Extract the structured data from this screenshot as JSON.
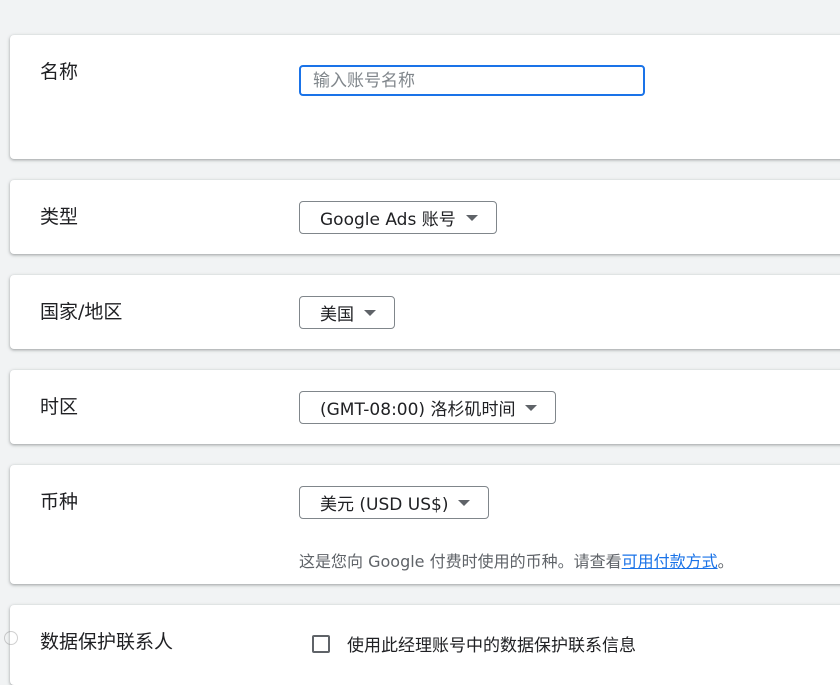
{
  "form": {
    "name": {
      "label": "名称",
      "placeholder": "输入账号名称",
      "value": ""
    },
    "type": {
      "label": "类型",
      "selected": "Google Ads 账号"
    },
    "country": {
      "label": "国家/地区",
      "selected": "美国"
    },
    "timezone": {
      "label": "时区",
      "selected": "(GMT-08:00) 洛杉矶时间"
    },
    "currency": {
      "label": "币种",
      "selected": "美元 (USD US$)",
      "helper_text": "这是您向 Google 付费时使用的币种。请查看",
      "helper_link": "可用付款方式",
      "helper_suffix": "。"
    },
    "data_protection": {
      "label": "数据保护联系人",
      "checkbox_label": "使用此经理账号中的数据保护联系信息",
      "checked": false
    }
  },
  "colors": {
    "accent": "#1a73e8",
    "background": "#f1f3f4",
    "card": "#ffffff"
  }
}
